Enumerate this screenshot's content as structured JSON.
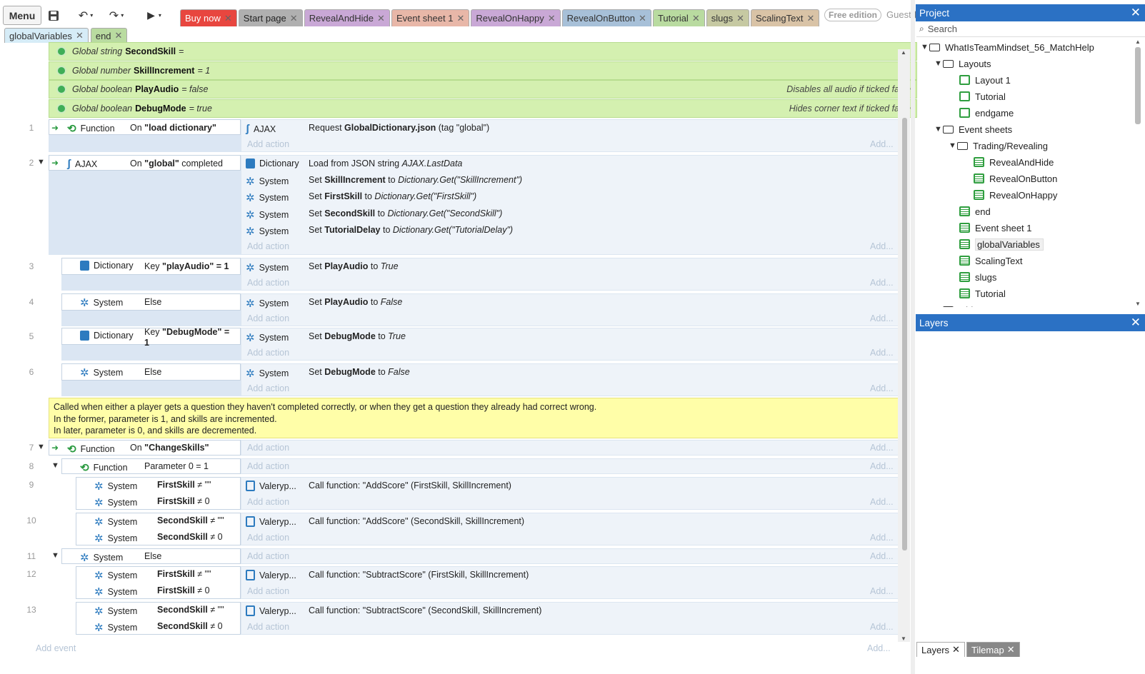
{
  "toolbar": {
    "menu": "Menu",
    "free_edition": "Free edition",
    "guest": "Guest"
  },
  "tabs": [
    {
      "label": "Buy now",
      "color": "#e8463f",
      "text": "#ffffff"
    },
    {
      "label": "Start page",
      "color": "#b0b0b0",
      "text": "#222222"
    },
    {
      "label": "RevealAndHide",
      "color": "#c9a8d6",
      "text": "#333333"
    },
    {
      "label": "Event sheet 1",
      "color": "#e8b7a8",
      "text": "#333333"
    },
    {
      "label": "RevealOnHappy",
      "color": "#c9a8d6",
      "text": "#333333"
    },
    {
      "label": "RevealOnButton",
      "color": "#a7c0d8",
      "text": "#333333"
    },
    {
      "label": "Tutorial",
      "color": "#b9dba0",
      "text": "#333333"
    },
    {
      "label": "slugs",
      "color": "#c6c9a2",
      "text": "#333333"
    },
    {
      "label": "ScalingText",
      "color": "#d9c3a6",
      "text": "#333333"
    }
  ],
  "tabs2": [
    {
      "label": "globalVariables",
      "color": "#d6ecf7"
    },
    {
      "label": "end",
      "color": "#b9dba0"
    }
  ],
  "globals": [
    {
      "type": "Global string",
      "name": "SecondSkill",
      "value": "=",
      "comment": ""
    },
    {
      "type": "Global number",
      "name": "SkillIncrement",
      "value": "= 1",
      "comment": ""
    },
    {
      "type": "Global boolean",
      "name": "PlayAudio",
      "value": "= false",
      "comment": "Disables all audio if ticked false"
    },
    {
      "type": "Global boolean",
      "name": "DebugMode",
      "value": "= true",
      "comment": "Hides corner text if ticked false"
    }
  ],
  "labels": {
    "add_action": "Add action",
    "add_dots": "Add...",
    "add_event": "Add event"
  },
  "events": {
    "e1": {
      "num": "1",
      "obj": "Function",
      "cond_pre": "On ",
      "cond_bold": "\"load dictionary\"",
      "a1_obj": "AJAX",
      "a1_pre": "Request ",
      "a1_bold": "GlobalDictionary.json",
      "a1_post": " (tag \"global\")"
    },
    "e2": {
      "num": "2",
      "obj": "AJAX",
      "cond_pre": "On ",
      "cond_bold": "\"global\"",
      "cond_post": " completed",
      "a1_obj": "Dictionary",
      "a1_text": "Load from JSON string ",
      "a1_it": "AJAX.LastData",
      "acts": [
        {
          "obj": "System",
          "pre": "Set ",
          "bold": "SkillIncrement",
          "mid": " to ",
          "it": "Dictionary.Get(\"SkillIncrement\")"
        },
        {
          "obj": "System",
          "pre": "Set ",
          "bold": "FirstSkill",
          "mid": " to ",
          "it": "Dictionary.Get(\"FirstSkill\")"
        },
        {
          "obj": "System",
          "pre": "Set ",
          "bold": "SecondSkill",
          "mid": " to ",
          "it": "Dictionary.Get(\"SecondSkill\")"
        },
        {
          "obj": "System",
          "pre": "Set ",
          "bold": "TutorialDelay",
          "mid": " to ",
          "it": "Dictionary.Get(\"TutorialDelay\")"
        }
      ]
    },
    "e3": {
      "num": "3",
      "obj": "Dictionary",
      "cond_pre": "Key ",
      "cond_bold": "\"playAudio\" = 1",
      "a_obj": "System",
      "a_pre": "Set ",
      "a_bold": "PlayAudio",
      "a_mid": " to ",
      "a_it": "True"
    },
    "e4": {
      "num": "4",
      "obj": "System",
      "cond": "Else",
      "a_obj": "System",
      "a_pre": "Set ",
      "a_bold": "PlayAudio",
      "a_mid": " to ",
      "a_it": "False"
    },
    "e5": {
      "num": "5",
      "obj": "Dictionary",
      "cond_pre": "Key ",
      "cond_bold": "\"DebugMode\" =",
      "cond_bold2": "1",
      "a_obj": "System",
      "a_pre": "Set ",
      "a_bold": "DebugMode",
      "a_mid": " to ",
      "a_it": "True"
    },
    "e6": {
      "num": "6",
      "obj": "System",
      "cond": "Else",
      "a_obj": "System",
      "a_pre": "Set ",
      "a_bold": "DebugMode",
      "a_mid": " to ",
      "a_it": "False"
    },
    "comment": [
      "Called when either a player gets a question they haven't completed correctly, or when they get a question they already had correct wrong.",
      "In the former, parameter is 1, and skills are incremented.",
      "In later, parameter is 0, and skills are decremented."
    ],
    "e7": {
      "num": "7",
      "obj": "Function",
      "cond_pre": "On ",
      "cond_bold": "\"ChangeSkills\""
    },
    "e8": {
      "num": "8",
      "obj": "Function",
      "cond": "Parameter 0 = 1"
    },
    "e9": {
      "num": "9",
      "c1_obj": "System",
      "c1_bold": "FirstSkill",
      "c1_post": " ≠ \"\"",
      "c2_obj": "System",
      "c2_bold": "FirstSkill",
      "c2_post": " ≠ 0",
      "a_obj": "Valeryp...",
      "a_text": "Call function: \"AddScore\" (FirstSkill, SkillIncrement)"
    },
    "e10": {
      "num": "10",
      "c1_obj": "System",
      "c1_bold": "SecondSkill",
      "c1_post": " ≠ \"\"",
      "c2_obj": "System",
      "c2_bold": "SecondSkill",
      "c2_post": " ≠ 0",
      "a_obj": "Valeryp...",
      "a_text": "Call function: \"AddScore\" (SecondSkill, SkillIncrement)"
    },
    "e11": {
      "num": "11",
      "obj": "System",
      "cond": "Else"
    },
    "e12": {
      "num": "12",
      "c1_obj": "System",
      "c1_bold": "FirstSkill",
      "c1_post": " ≠ \"\"",
      "c2_obj": "System",
      "c2_bold": "FirstSkill",
      "c2_post": " ≠ 0",
      "a_obj": "Valeryp...",
      "a_text": "Call function: \"SubtractScore\" (FirstSkill, SkillIncrement)"
    },
    "e13": {
      "num": "13",
      "c1_obj": "System",
      "c1_bold": "SecondSkill",
      "c1_post": " ≠ \"\"",
      "c2_obj": "System",
      "c2_bold": "SecondSkill",
      "c2_post": " ≠ 0",
      "a_obj": "Valeryp...",
      "a_text": "Call function: \"SubtractScore\" (SecondSkill, SkillIncrement)"
    }
  },
  "project": {
    "title": "Project",
    "search_placeholder": "Search",
    "tree": {
      "root": "WhatIsTeamMindset_56_MatchHelp",
      "layouts": "Layouts",
      "layout_items": [
        "Layout 1",
        "Tutorial",
        "endgame"
      ],
      "event_sheets": "Event sheets",
      "trading": "Trading/Revealing",
      "trading_items": [
        "RevealAndHide",
        "RevealOnButton",
        "RevealOnHappy"
      ],
      "sheet_items": [
        "end",
        "Event sheet 1",
        "globalVariables",
        "ScalingText",
        "slugs",
        "Tutorial"
      ],
      "partial": "Object types"
    }
  },
  "layers": {
    "title": "Layers"
  },
  "bottom_tabs": [
    {
      "label": "Layers"
    },
    {
      "label": "Tilemap"
    }
  ]
}
